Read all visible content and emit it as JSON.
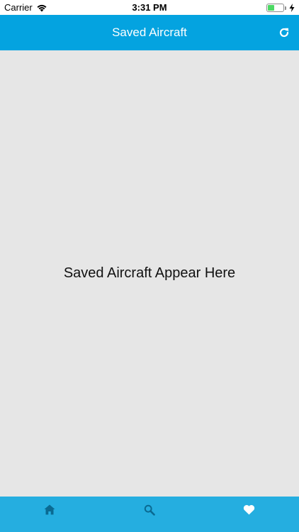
{
  "status_bar": {
    "carrier": "Carrier",
    "time": "3:31 PM",
    "battery_level": 0.45,
    "battery_color": "#4cd964",
    "icons": [
      "wifi-icon",
      "battery-icon",
      "charging-bolt-icon"
    ]
  },
  "nav_bar": {
    "title": "Saved Aircraft",
    "background": "#04a3e0",
    "actions": [
      "refresh-icon"
    ]
  },
  "content": {
    "empty_message": "Saved Aircraft Appear Here",
    "background": "#e6e6e6"
  },
  "tab_bar": {
    "background": "#25aee0",
    "tabs": [
      {
        "icon": "home-icon",
        "active": false
      },
      {
        "icon": "search-icon",
        "active": false
      },
      {
        "icon": "heart-icon",
        "active": true
      }
    ],
    "inactive_color": "#0a6a92",
    "active_color": "#ffffff"
  }
}
